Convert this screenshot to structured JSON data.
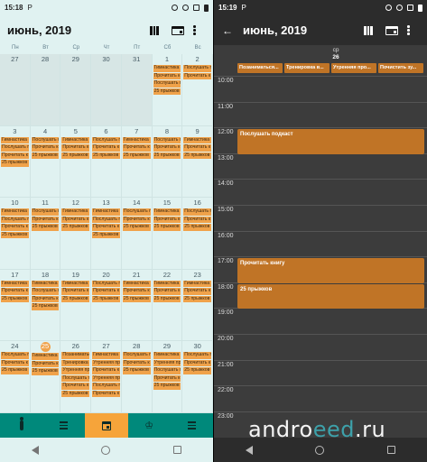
{
  "left": {
    "status": {
      "time": "15:18",
      "carrier_icon": "P"
    },
    "header": {
      "title": "июнь, 2019"
    },
    "weekdays": [
      "Пн",
      "Вт",
      "Ср",
      "Чт",
      "Пт",
      "Сб",
      "Вс"
    ],
    "weeks": [
      [
        {
          "day": "27",
          "other": true,
          "events": []
        },
        {
          "day": "28",
          "other": true,
          "events": []
        },
        {
          "day": "29",
          "other": true,
          "events": []
        },
        {
          "day": "30",
          "other": true,
          "events": []
        },
        {
          "day": "31",
          "other": true,
          "events": []
        },
        {
          "day": "1",
          "events": [
            "Гимнастика",
            "Прочитать к",
            "Послушать п",
            "25 прыжков"
          ]
        },
        {
          "day": "2",
          "events": [
            "Послушать п",
            "Прочитать к"
          ]
        }
      ],
      [
        {
          "day": "3",
          "events": [
            "Гимнастика",
            "Послушать п",
            "Прочитать к",
            "25 прыжков"
          ]
        },
        {
          "day": "4",
          "events": [
            "Послушать п",
            "Прочитать к",
            "25 прыжков"
          ]
        },
        {
          "day": "5",
          "events": [
            "Гимнастика",
            "Прочитать к",
            "25 прыжков"
          ]
        },
        {
          "day": "6",
          "events": [
            "Послушать п",
            "Прочитать к",
            "25 прыжков"
          ]
        },
        {
          "day": "7",
          "events": [
            "Гимнастика",
            "Прочитать к",
            "25 прыжков"
          ]
        },
        {
          "day": "8",
          "events": [
            "Послушать п",
            "Прочитать к",
            "25 прыжков"
          ]
        },
        {
          "day": "9",
          "events": [
            "Гимнастика",
            "Прочитать к",
            "25 прыжков"
          ]
        }
      ],
      [
        {
          "day": "10",
          "events": [
            "Гимнастика",
            "Послушать п",
            "Прочитать к",
            "25 прыжков"
          ]
        },
        {
          "day": "11",
          "events": [
            "Послушать п",
            "Прочитать к",
            "25 прыжков"
          ]
        },
        {
          "day": "12",
          "events": [
            "Гимнастика",
            "Прочитать к",
            "25 прыжков"
          ]
        },
        {
          "day": "13",
          "events": [
            "Гимнастика",
            "Послушать п",
            "Прочитать к",
            "25 прыжков"
          ]
        },
        {
          "day": "14",
          "events": [
            "Послушать п",
            "Прочитать к",
            "25 прыжков"
          ]
        },
        {
          "day": "15",
          "events": [
            "Гимнастика",
            "Прочитать к",
            "25 прыжков"
          ]
        },
        {
          "day": "16",
          "events": [
            "Послушать п",
            "Прочитать к",
            "25 прыжков"
          ]
        }
      ],
      [
        {
          "day": "17",
          "events": [
            "Гимнастика",
            "Прочитать к",
            "25 прыжков"
          ]
        },
        {
          "day": "18",
          "events": [
            "Гимнастика",
            "Послушать п",
            "Прочитать к",
            "25 прыжков"
          ]
        },
        {
          "day": "19",
          "events": [
            "Гимнастика",
            "Прочитать к",
            "25 прыжков"
          ]
        },
        {
          "day": "20",
          "events": [
            "Послушать п",
            "Прочитать к",
            "25 прыжков"
          ]
        },
        {
          "day": "21",
          "events": [
            "Гимнастика",
            "Прочитать к",
            "25 прыжков"
          ]
        },
        {
          "day": "22",
          "events": [
            "Гимнастика",
            "Прочитать к",
            "25 прыжков"
          ]
        },
        {
          "day": "23",
          "events": [
            "Гимнастика",
            "Прочитать к",
            "25 прыжков"
          ]
        }
      ],
      [
        {
          "day": "24",
          "events": [
            "Послушать п",
            "Прочитать к",
            "25 прыжков"
          ]
        },
        {
          "day": "25",
          "today": true,
          "events": [
            "Гимнастика",
            "Прочитать к",
            "25 прыжков"
          ]
        },
        {
          "day": "26",
          "events": [
            "Позаниматься",
            "Тренировка",
            "Утренняя пр",
            "Послушать п",
            "Прочитать к",
            "25 прыжков"
          ]
        },
        {
          "day": "27",
          "events": [
            "Гимнастика",
            "Утренняя пр",
            "Прочитать к",
            "Утренняя пр",
            "Послушать п",
            "Прочитать к"
          ]
        },
        {
          "day": "28",
          "events": [
            "Послушать п",
            "Прочитать к",
            "25 прыжков"
          ]
        },
        {
          "day": "29",
          "events": [
            "Гимнастика",
            "Утренняя пр",
            "Послушать п",
            "Прочитать к",
            "25 прыжков"
          ]
        },
        {
          "day": "30",
          "events": [
            "Послушать п",
            "Прочитать к",
            "25 прыжков"
          ]
        }
      ]
    ]
  },
  "right": {
    "status": {
      "time": "15:19",
      "carrier_icon": "P"
    },
    "header": {
      "title": "июнь, 2019"
    },
    "day": {
      "weekday": "ср",
      "number": "26"
    },
    "allday_events": [
      "Позаниматься...",
      "Тренировка в...",
      "Утренняя про...",
      "Почистить зу..."
    ],
    "hours": [
      "10:00",
      "11:00",
      "12:00",
      "13:00",
      "14:00",
      "15:00",
      "16:00",
      "17:00",
      "18:00",
      "19:00",
      "20:00",
      "21:00",
      "22:00",
      "23:00"
    ],
    "events": [
      {
        "title": "Послушать подкаст",
        "start": 12.0,
        "end": 13.0
      },
      {
        "title": "Прочитать книгу",
        "start": 17.0,
        "end": 18.0
      },
      {
        "title": "25 прыжков",
        "start": 18.0,
        "end": 19.0
      }
    ]
  },
  "watermark": {
    "part1": "andro",
    "part2": "eed",
    "part3": ".ru"
  },
  "colors": {
    "event_light": "#f0a24a",
    "event_dark": "#c07426",
    "nav_bg": "#00897b",
    "nav_active": "#f6a43a"
  }
}
